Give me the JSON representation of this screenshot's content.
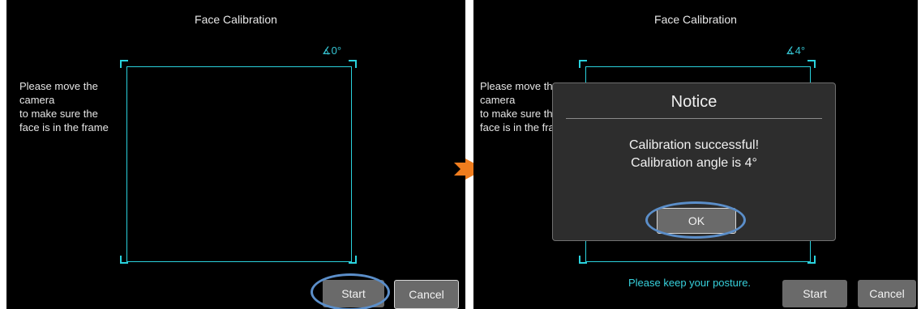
{
  "left_screen": {
    "title": "Face Calibration",
    "angle": "∡0°",
    "instruction_lines": [
      "Please move the",
      "camera",
      "to make sure the",
      "face is in the frame"
    ],
    "start_label": "Start",
    "cancel_label": "Cancel"
  },
  "right_screen": {
    "title": "Face Calibration",
    "angle": "∡4°",
    "instruction_lines": [
      "Please move the",
      "camera",
      "to make sure the",
      "face is in the frame"
    ],
    "dialog": {
      "title": "Notice",
      "message_line1": "Calibration successful!",
      "message_line2": "Calibration angle is 4°",
      "ok_label": "OK"
    },
    "posture_hint": "Please keep your posture.",
    "start_label": "Start",
    "cancel_label": "Cancel"
  },
  "colors": {
    "frame": "#2ad2dd",
    "highlight_ring": "#5b8ec9",
    "arrow": "#f07d1e"
  }
}
